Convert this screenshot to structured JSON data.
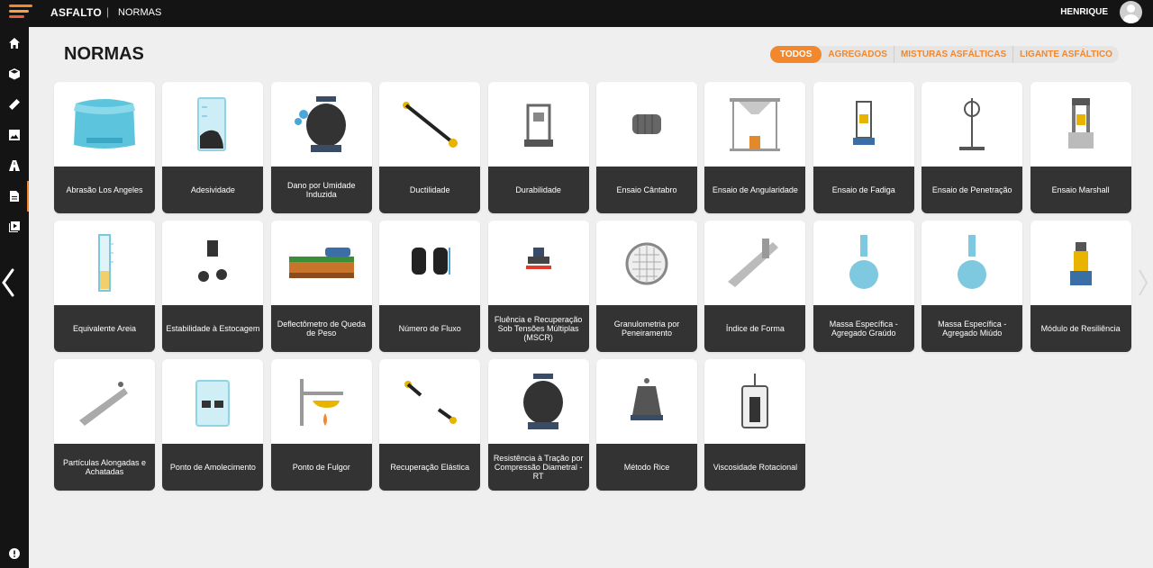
{
  "topbar": {
    "app_name": "ASFALTO",
    "separator": "|",
    "section": "NORMAS",
    "username": "HENRIQUE"
  },
  "page": {
    "title": "NORMAS"
  },
  "filters": [
    {
      "label": "TODOS",
      "active": true
    },
    {
      "label": "AGREGADOS",
      "active": false
    },
    {
      "label": "MISTURAS ASFÁLTICAS",
      "active": false
    },
    {
      "label": "LIGANTE ASFÁLTICO",
      "active": false
    }
  ],
  "colors": {
    "accent": "#f2872d",
    "card_label_bg": "#333333",
    "topbar": "#141414",
    "background": "#efefef"
  },
  "sidebar_icons": [
    "home-icon",
    "cube-icon",
    "ruler-icon",
    "image-icon",
    "road-icon",
    "document-icon",
    "play-icon",
    "info-icon"
  ],
  "cards": [
    {
      "label": "Abrasão Los Angeles",
      "icon": "los-angeles-drum-icon"
    },
    {
      "label": "Adesividade",
      "icon": "beaker-icon"
    },
    {
      "label": "Dano por Umidade Induzida",
      "icon": "specimen-moisture-icon"
    },
    {
      "label": "Ductilidade",
      "icon": "ductility-icon"
    },
    {
      "label": "Durabilidade",
      "icon": "press-machine-icon"
    },
    {
      "label": "Ensaio Cântabro",
      "icon": "drum-icon"
    },
    {
      "label": "Ensaio de Angularidade",
      "icon": "funnel-stand-icon"
    },
    {
      "label": "Ensaio de Fadiga",
      "icon": "fatigue-machine-icon"
    },
    {
      "label": "Ensaio de Penetração",
      "icon": "penetrometer-icon"
    },
    {
      "label": "Ensaio Marshall",
      "icon": "marshall-press-icon"
    },
    {
      "label": "Equivalente Areia",
      "icon": "graduated-cylinder-icon"
    },
    {
      "label": "Estabilidade à Estocagem",
      "icon": "storage-tubes-icon"
    },
    {
      "label": "Deflectômetro de Queda de Peso",
      "icon": "fwd-truck-icon"
    },
    {
      "label": "Número de Fluxo",
      "icon": "specimens-icon"
    },
    {
      "label": "Fluência e Recuperação Sob Tensões Múltiplas (MSCR)",
      "icon": "rheometer-icon"
    },
    {
      "label": "Granulometria por Peneiramento",
      "icon": "sieve-icon"
    },
    {
      "label": "Índice de Forma",
      "icon": "caliper-icon"
    },
    {
      "label": "Massa Específica - Agregado Graúdo",
      "icon": "flask-icon"
    },
    {
      "label": "Massa Específica - Agregado Miúdo",
      "icon": "flask-icon"
    },
    {
      "label": "Módulo de Resiliência",
      "icon": "resilience-machine-icon"
    },
    {
      "label": "Partículas Alongadas e Achatadas",
      "icon": "proportional-caliper-icon"
    },
    {
      "label": "Ponto de Amolecimento",
      "icon": "ring-ball-icon"
    },
    {
      "label": "Ponto de Fulgor",
      "icon": "flash-point-icon"
    },
    {
      "label": "Recuperação Elástica",
      "icon": "elastic-recovery-icon"
    },
    {
      "label": "Resistência à Tração por Compressão Diametral - RT",
      "icon": "specimen-icon"
    },
    {
      "label": "Método Rice",
      "icon": "rice-pycnometer-icon"
    },
    {
      "label": "Viscosidade Rotacional",
      "icon": "viscometer-icon"
    }
  ]
}
